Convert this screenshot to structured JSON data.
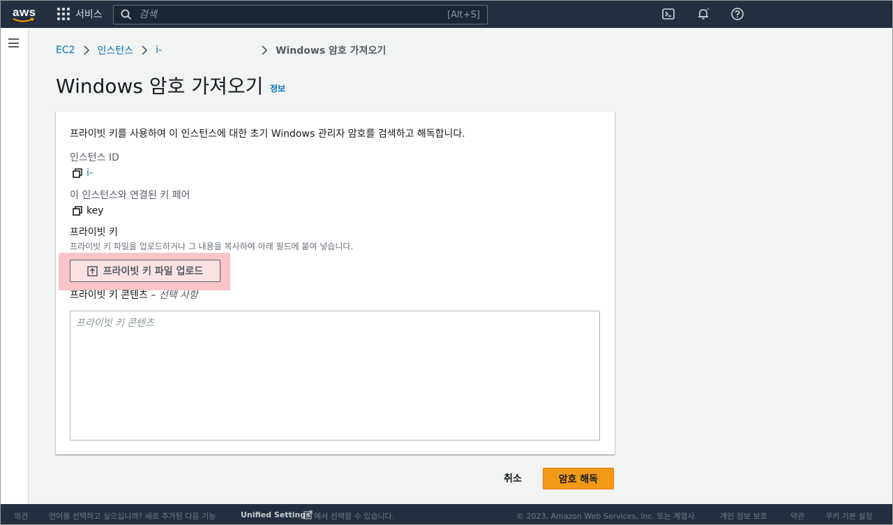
{
  "topnav": {
    "logo_text": "aws",
    "services_label": "서비스",
    "search_placeholder": "검색",
    "search_shortcut": "[Alt+S]",
    "icons": [
      "cloudshell-icon",
      "bell-icon",
      "help-icon"
    ]
  },
  "breadcrumb": {
    "items": [
      "EC2",
      "인스턴스",
      "i-"
    ],
    "current": "Windows 암호 가져오기"
  },
  "page": {
    "title": "Windows 암호 가져오기",
    "info_link": "정보"
  },
  "panel": {
    "description": "프라이빗 키를 사용하여 이 인스턴스에 대한 초기 Windows 관리자 암호를 검색하고 해독합니다.",
    "instance_id_label": "인스턴스 ID",
    "instance_id_value": "i-",
    "key_pair_label": "이 인스턴스와 연결된 키 페어",
    "key_pair_value": "key",
    "private_key_label": "프라이빗 키",
    "private_key_hint": "프라이빗 키 파일을 업로드하거나 그 내용을 복사하여 아래 필드에 붙여 넣습니다.",
    "upload_button": "프라이빗 키 파일 업로드",
    "content_label": "프라이빗 키 콘텐츠 – ",
    "content_optional": "선택 사항",
    "content_placeholder": "프라이빗 키 콘텐츠",
    "content_value": ""
  },
  "actions": {
    "cancel": "취소",
    "decrypt": "암호 해독"
  },
  "footer": {
    "feedback": "의견",
    "language_prompt": "언어를 선택하고 싶으십니까? 새로 추가된 다음 기능",
    "unified_settings": "Unified Settings",
    "language_suffix": "에서 선택할 수 있습니다.",
    "copyright": "© 2023, Amazon Web Services, Inc. 또는 계열사.",
    "privacy": "개인 정보 보호",
    "terms": "약관",
    "cookies": "쿠키 기본 설정"
  },
  "colors": {
    "nav_bg": "#232f3e",
    "link": "#0073bb",
    "primary": "#f29a18",
    "highlight": "#f9c5c9"
  }
}
